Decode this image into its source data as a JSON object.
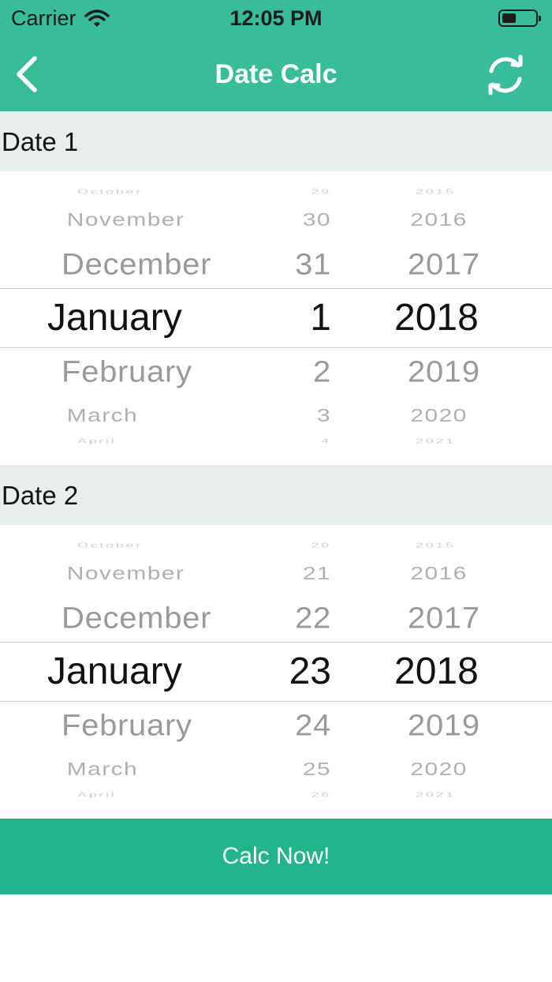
{
  "status_bar": {
    "carrier": "Carrier",
    "time": "12:05 PM",
    "wifi_icon": "wifi-icon",
    "battery_icon": "battery-icon"
  },
  "nav": {
    "title": "Date Calc",
    "back_icon": "chevron-left-icon",
    "refresh_icon": "refresh-icon"
  },
  "date1": {
    "label": "Date 1",
    "month": {
      "above": [
        "October",
        "November",
        "December"
      ],
      "selected": "January",
      "below": [
        "February",
        "March",
        "April"
      ]
    },
    "day": {
      "above": [
        "29",
        "30",
        "31"
      ],
      "selected": "1",
      "below": [
        "2",
        "3",
        "4"
      ]
    },
    "year": {
      "above": [
        "2015",
        "2016",
        "2017"
      ],
      "selected": "2018",
      "below": [
        "2019",
        "2020",
        "2021"
      ]
    }
  },
  "date2": {
    "label": "Date 2",
    "month": {
      "above": [
        "October",
        "November",
        "December"
      ],
      "selected": "January",
      "below": [
        "February",
        "March",
        "April"
      ]
    },
    "day": {
      "above": [
        "20",
        "21",
        "22"
      ],
      "selected": "23",
      "below": [
        "24",
        "25",
        "26"
      ]
    },
    "year": {
      "above": [
        "2015",
        "2016",
        "2017"
      ],
      "selected": "2018",
      "below": [
        "2019",
        "2020",
        "2021"
      ]
    }
  },
  "calc_button": "Calc Now!",
  "colors": {
    "header_green": "#38bd98",
    "button_green": "#22b58b",
    "section_bg": "#e8eeed"
  }
}
